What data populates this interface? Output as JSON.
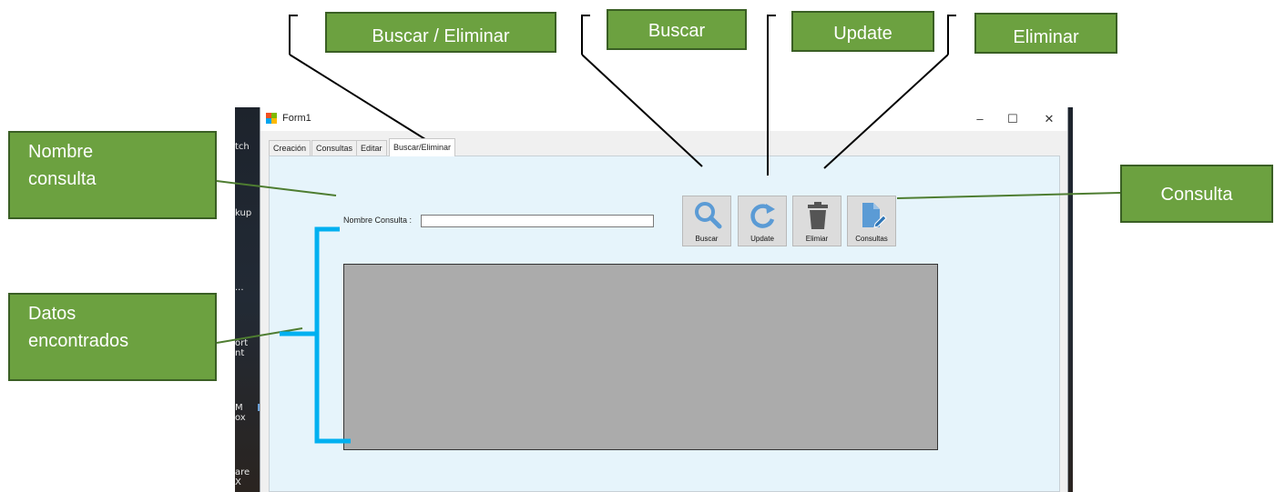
{
  "window": {
    "title": "Form1",
    "controls": {
      "minimize": "–",
      "maximize": "☐",
      "close": "✕"
    }
  },
  "desktop_labels": [
    "tch",
    "kup",
    "...",
    "ort\nnt",
    "M\nox",
    "are\nX"
  ],
  "tabs": [
    {
      "label": "Creación",
      "active": false
    },
    {
      "label": "Consultas",
      "active": false
    },
    {
      "label": "Editar",
      "active": false
    },
    {
      "label": "Buscar/Eliminar",
      "active": true
    }
  ],
  "form": {
    "nombre_label": "Nombre Consulta :",
    "nombre_value": ""
  },
  "toolbar": {
    "buscar_label": "Buscar",
    "update_label": "Update",
    "eliminar_label": "Elimiar",
    "consultas_label": "Consultas"
  },
  "callouts": {
    "buscar_eliminar": "Buscar / Eliminar",
    "buscar": "Buscar",
    "update": "Update",
    "eliminar": "Eliminar",
    "nombre_consulta_line1": "Nombre",
    "nombre_consulta_line2": "consulta",
    "datos_line1": "Datos",
    "datos_line2": "encontrados",
    "consulta": "Consulta"
  },
  "colors": {
    "callout_fill": "#6ca140",
    "callout_border": "#3a5f24",
    "bracket": "#00b0f0",
    "tab_page_bg": "#e6f4fb",
    "grid_bg": "#ababab",
    "icon_blue": "#5b9bd5",
    "icon_gray": "#555555"
  }
}
